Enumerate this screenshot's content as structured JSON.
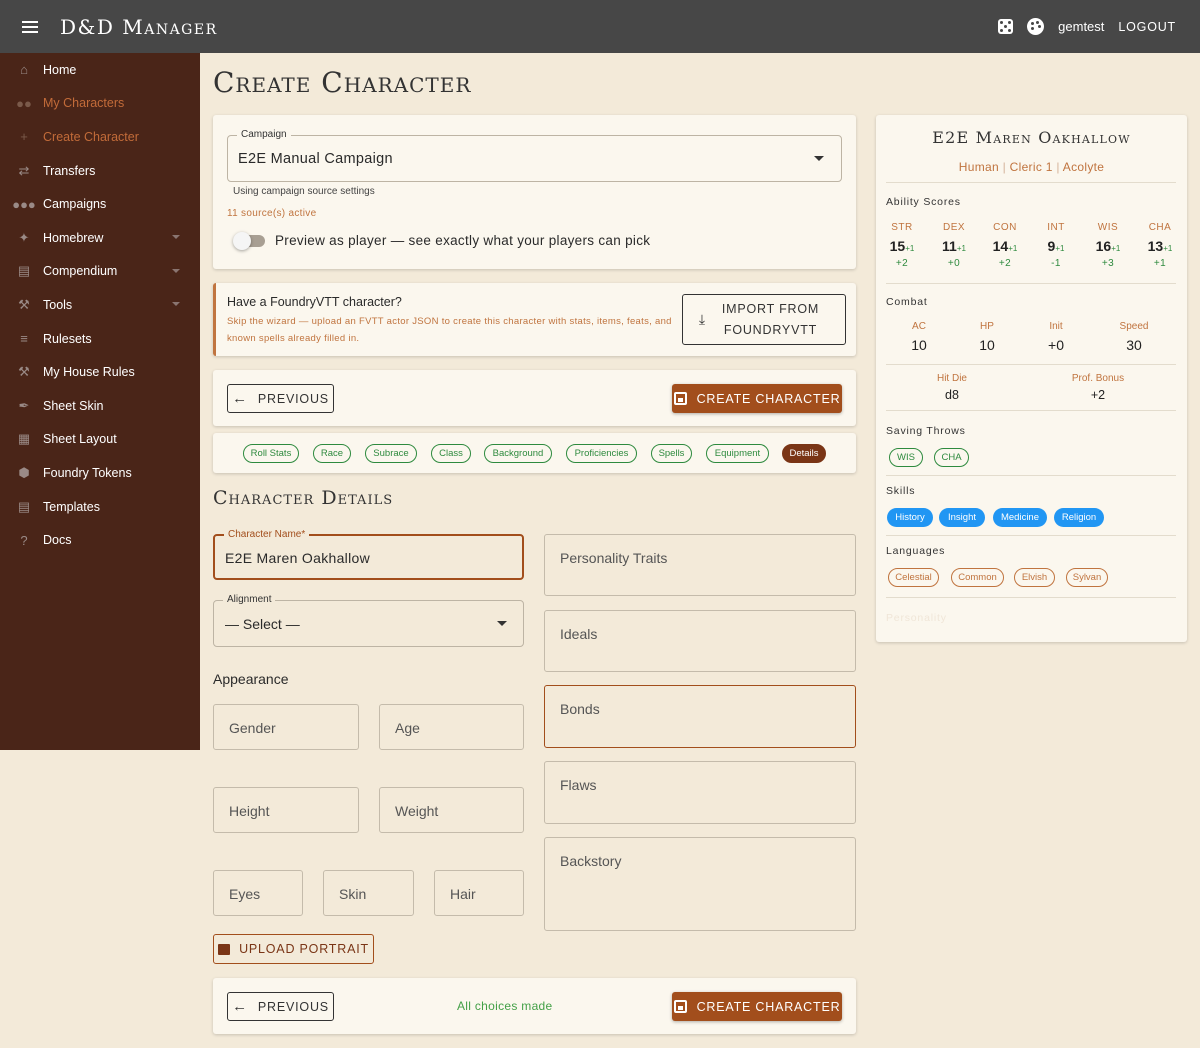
{
  "app": {
    "title": "D&D Manager",
    "user": "gemtest",
    "logout": "LOGOUT"
  },
  "sidebar": {
    "items": [
      {
        "label": "Home"
      },
      {
        "label": "My Characters"
      },
      {
        "label": "Create Character"
      },
      {
        "label": "Transfers"
      },
      {
        "label": "Campaigns"
      },
      {
        "label": "Homebrew"
      },
      {
        "label": "Compendium"
      },
      {
        "label": "Tools"
      },
      {
        "label": "Rulesets"
      },
      {
        "label": "My House Rules"
      },
      {
        "label": "Sheet Skin"
      },
      {
        "label": "Sheet Layout"
      },
      {
        "label": "Foundry Tokens"
      },
      {
        "label": "Templates"
      },
      {
        "label": "Docs"
      }
    ]
  },
  "page": {
    "title": "Create Character"
  },
  "campaign": {
    "label": "Campaign",
    "value": "E2E Manual Campaign",
    "helper": "Using campaign source settings",
    "sources": "11 source(s) active",
    "preview_label": "Preview as player — see exactly what your players can pick"
  },
  "foundry": {
    "title": "Have a FoundryVTT character?",
    "desc": "Skip the wizard — upload an FVTT actor JSON to create this character with stats, items, feats, and known spells already filled in.",
    "button_line1": "IMPORT FROM",
    "button_line2": "FOUNDRYVTT"
  },
  "nav": {
    "previous": "PREVIOUS",
    "create": "CREATE CHARACTER",
    "status": "All choices made"
  },
  "steps": [
    "Roll Stats",
    "Race",
    "Subrace",
    "Class",
    "Background",
    "Proficiencies",
    "Spells",
    "Equipment",
    "Details"
  ],
  "details": {
    "section_title": "Character Details",
    "name_label": "Character Name*",
    "name_value": "E2E Maren Oakhallow",
    "alignment_label": "Alignment",
    "alignment_value": "— Select —",
    "appearance_title": "Appearance",
    "gender": "Gender",
    "age": "Age",
    "height": "Height",
    "weight": "Weight",
    "eyes": "Eyes",
    "skin": "Skin",
    "hair": "Hair",
    "upload": "UPLOAD PORTRAIT",
    "personality": "Personality Traits",
    "ideals": "Ideals",
    "bonds": "Bonds",
    "flaws": "Flaws",
    "backstory": "Backstory"
  },
  "preview": {
    "name": "E2E Maren Oakhallow",
    "race": "Human",
    "class": "Cleric 1",
    "background": "Acolyte",
    "sep": "|",
    "ability_title": "Ability Scores",
    "abilities": [
      {
        "abbr": "STR",
        "score": "15",
        "bonus": "+1",
        "mod": "+2"
      },
      {
        "abbr": "DEX",
        "score": "11",
        "bonus": "+1",
        "mod": "+0"
      },
      {
        "abbr": "CON",
        "score": "14",
        "bonus": "+1",
        "mod": "+2"
      },
      {
        "abbr": "INT",
        "score": "9",
        "bonus": "+1",
        "mod": "-1"
      },
      {
        "abbr": "WIS",
        "score": "16",
        "bonus": "+1",
        "mod": "+3"
      },
      {
        "abbr": "CHA",
        "score": "13",
        "bonus": "+1",
        "mod": "+1"
      }
    ],
    "combat_title": "Combat",
    "combat": [
      {
        "label": "AC",
        "value": "10"
      },
      {
        "label": "HP",
        "value": "10"
      },
      {
        "label": "Init",
        "value": "+0"
      },
      {
        "label": "Speed",
        "value": "30"
      }
    ],
    "hit_die_label": "Hit Die",
    "hit_die": "d8",
    "prof_label": "Prof. Bonus",
    "prof": "+2",
    "saves_title": "Saving Throws",
    "saves": [
      "WIS",
      "CHA"
    ],
    "skills_title": "Skills",
    "skills": [
      "History",
      "Insight",
      "Medicine",
      "Religion"
    ],
    "languages_title": "Languages",
    "languages": [
      "Celestial",
      "Common",
      "Elvish",
      "Sylvan"
    ],
    "personality_title": "Personality"
  },
  "colors": {
    "topbar": "#474747",
    "sidebar": "#4a2518",
    "accent": "#a24e1c",
    "green": "#2e8a3e",
    "blue": "#2196f3",
    "orange": "#c0743f"
  }
}
